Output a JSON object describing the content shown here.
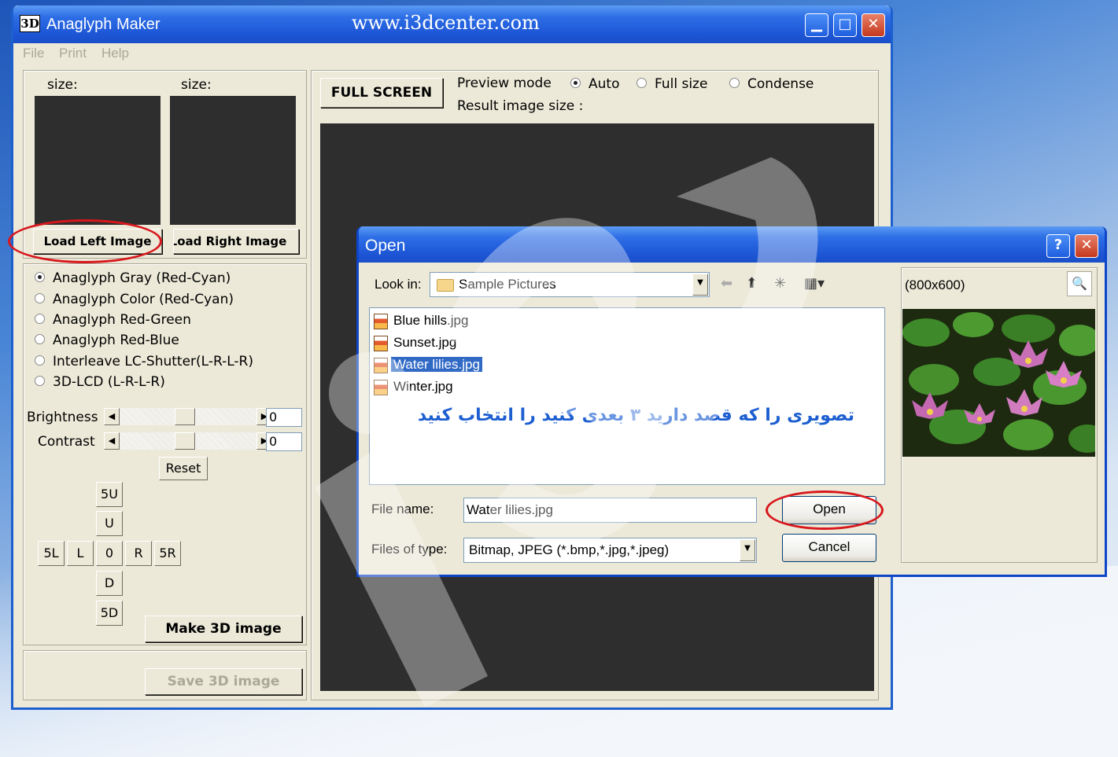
{
  "main_window": {
    "title": "Anaglyph Maker",
    "logo": "3D",
    "url": "www.i3dcenter.com",
    "menu": [
      "File",
      "Print",
      "Help"
    ],
    "left_size_label": "size:",
    "right_size_label": "size:",
    "load_left": "Load Left Image",
    "load_right": "Load Right Image",
    "full_screen": "FULL SCREEN",
    "preview_mode_label": "Preview mode",
    "preview_modes": [
      "Auto",
      "Full size",
      "Condense"
    ],
    "preview_mode_selected": "Auto",
    "result_size_label": "Result image size :",
    "modes": [
      "Anaglyph Gray (Red-Cyan)",
      "Anaglyph Color (Red-Cyan)",
      "Anaglyph Red-Green",
      "Anaglyph Red-Blue",
      "Interleave LC-Shutter(L-R-L-R)",
      "3D-LCD (L-R-L-R)"
    ],
    "mode_selected": "Anaglyph Gray (Red-Cyan)",
    "brightness_label": "Brightness",
    "brightness_value": "0",
    "contrast_label": "Contrast",
    "contrast_value": "0",
    "reset": "Reset",
    "nudge": {
      "up5": "5U",
      "up": "U",
      "left5": "5L",
      "left": "L",
      "center": "0",
      "right": "R",
      "right5": "5R",
      "down": "D",
      "down5": "5D"
    },
    "make_3d": "Make 3D image",
    "save_3d": "Save 3D image"
  },
  "open_dialog": {
    "title": "Open",
    "look_in_label": "Look in:",
    "look_in_value": "Sample Pictures",
    "files": [
      "Blue hills.jpg",
      "Sunset.jpg",
      "Water lilies.jpg",
      "Winter.jpg"
    ],
    "selected_file": "Water lilies.jpg",
    "instruction": "تصویری را که قصد دارید ۳ بعدی کنید را انتخاب کنید",
    "file_name_label": "File name:",
    "file_name_value": "Water lilies.jpg",
    "files_of_type_label": "Files of type:",
    "files_of_type_value": "Bitmap, JPEG (*.bmp,*.jpg,*.jpeg)",
    "open": "Open",
    "cancel": "Cancel",
    "preview_size": "(800x600)"
  },
  "colors": {
    "titlebar": "#1c54d4",
    "highlight": "#316ac5",
    "annotation_ring": "#d8171d",
    "instruction_text": "#1d5fd1"
  }
}
